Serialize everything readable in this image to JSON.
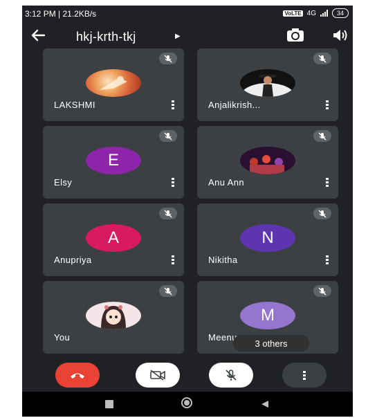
{
  "status": {
    "time": "3:12 PM | 21.2KB/s",
    "volte": "VoLTE",
    "network": "4G",
    "battery": "34"
  },
  "topbar": {
    "meeting_code": "hkj-krth-tkj"
  },
  "participants": [
    {
      "name": "LAKSHMI",
      "avatar": "photo",
      "muted": true,
      "has_menu": true
    },
    {
      "name": "Anjalikrish...",
      "avatar": "photo",
      "muted": true,
      "has_menu": true
    },
    {
      "name": "Elsy",
      "avatar": "E",
      "avatar_color": "#8e24aa",
      "muted": true,
      "has_menu": true
    },
    {
      "name": "Anu Ann",
      "avatar": "photo",
      "muted": true,
      "has_menu": true
    },
    {
      "name": "Anupriya",
      "avatar": "A",
      "avatar_color": "#d81b60",
      "muted": true,
      "has_menu": true
    },
    {
      "name": "Nikitha",
      "avatar": "N",
      "avatar_color": "#5e35b1",
      "muted": true,
      "has_menu": true
    },
    {
      "name": "You",
      "avatar": "photo",
      "muted": true,
      "has_menu": false
    },
    {
      "name": "Meenu",
      "avatar": "M",
      "avatar_color": "#9575cd",
      "muted": true,
      "has_menu": false
    }
  ],
  "others_label": "3 others",
  "controls": [
    "end-call",
    "camera-off",
    "mic-off",
    "more-options"
  ],
  "colors": {
    "background": "#202124",
    "tile": "#3c4043",
    "end_call": "#ea4335"
  }
}
